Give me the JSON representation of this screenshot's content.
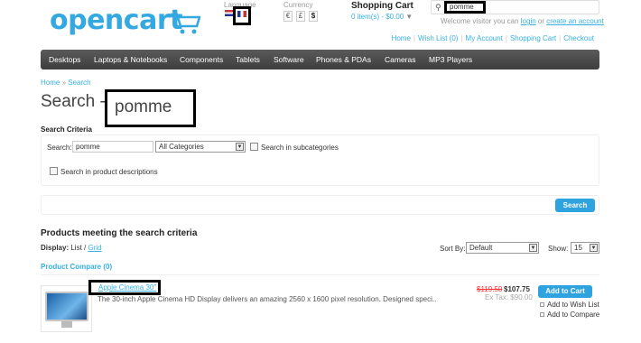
{
  "header": {
    "logo_text": "opencart",
    "language_label": "Language",
    "currency_label": "Currency",
    "currencies": [
      "€",
      "£",
      "$"
    ],
    "cart_title": "Shopping Cart",
    "cart_items": "0 item(s) - $0.00",
    "search_value": "pomme",
    "welcome": {
      "prefix": "Welcome visitor you can ",
      "login": "login",
      "or": " or ",
      "create": "create an account"
    }
  },
  "toplinks": [
    "Home",
    "Wish List (0)",
    "My Account",
    "Shopping Cart",
    "Checkout"
  ],
  "menu": [
    "Desktops",
    "Laptops & Notebooks",
    "Components",
    "Tablets",
    "Software",
    "Phones & PDAs",
    "Cameras",
    "MP3 Players"
  ],
  "breadcrumb": {
    "home": "Home",
    "sep": " » ",
    "current": "Search"
  },
  "heading": {
    "prefix": "Search -",
    "query": "pomme"
  },
  "criteria": {
    "title": "Search Criteria",
    "search_label": "Search:",
    "search_value": "pomme",
    "category": "All Categories",
    "subcategories_label": "Search in subcategories",
    "descriptions_label": "Search in product descriptions",
    "button": "Search"
  },
  "results": {
    "title": "Products meeting the search criteria",
    "display_label": "Display:",
    "display_list": "List",
    "display_sep": " / ",
    "display_grid": "Grid",
    "sort_label": "Sort By:",
    "sort_value": "Default",
    "show_label": "Show:",
    "show_value": "15",
    "compare": "Product Compare (0)"
  },
  "product": {
    "name": "Apple Cinema 30\"",
    "description": "The 30-inch Apple Cinema HD Display delivers an amazing 2560 x 1600 pixel resolution. Designed speci..",
    "price_old": "$119.50",
    "price_new": "$107.75",
    "ex_tax": "Ex Tax: $90.00",
    "add_to_cart": "Add to Cart",
    "add_to_wishlist": "Add to Wish List",
    "add_to_compare": "Add to Compare"
  }
}
